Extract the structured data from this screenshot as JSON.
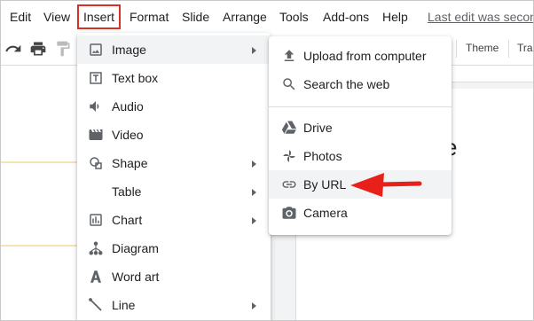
{
  "menubar": {
    "items": [
      "Edit",
      "View",
      "Insert",
      "Format",
      "Slide",
      "Arrange",
      "Tools",
      "Add-ons",
      "Help"
    ],
    "last_edit": "Last edit was seconds ago"
  },
  "toolbar": {
    "icons": [
      "redo-icon",
      "print-icon",
      "paint-format-icon"
    ],
    "theme_label": "Theme",
    "transition_label": "Transition"
  },
  "insert_menu": {
    "items": [
      {
        "label": "Image",
        "icon": "image-icon",
        "submenu": true
      },
      {
        "label": "Text box",
        "icon": "text-box-icon",
        "submenu": false
      },
      {
        "label": "Audio",
        "icon": "audio-icon",
        "submenu": false
      },
      {
        "label": "Video",
        "icon": "video-icon",
        "submenu": false
      },
      {
        "label": "Shape",
        "icon": "shape-icon",
        "submenu": true
      },
      {
        "label": "Table",
        "icon": "",
        "submenu": true
      },
      {
        "label": "Chart",
        "icon": "chart-icon",
        "submenu": true
      },
      {
        "label": "Diagram",
        "icon": "diagram-icon",
        "submenu": false
      },
      {
        "label": "Word art",
        "icon": "word-art-icon",
        "submenu": false
      },
      {
        "label": "Line",
        "icon": "line-icon",
        "submenu": true
      }
    ]
  },
  "image_submenu": {
    "items": [
      {
        "label": "Upload from computer",
        "icon": "upload-icon"
      },
      {
        "label": "Search the web",
        "icon": "search-icon"
      },
      {
        "label": "Drive",
        "icon": "drive-icon"
      },
      {
        "label": "Photos",
        "icon": "photos-icon"
      },
      {
        "label": "By URL",
        "icon": "link-icon"
      },
      {
        "label": "Camera",
        "icon": "camera-icon"
      }
    ]
  },
  "slide": {
    "title_fragment": "e"
  },
  "colors": {
    "annotation_arrow": "#e8201a",
    "active_menu_border": "#d93025",
    "highlight": "#f1f3f4"
  }
}
